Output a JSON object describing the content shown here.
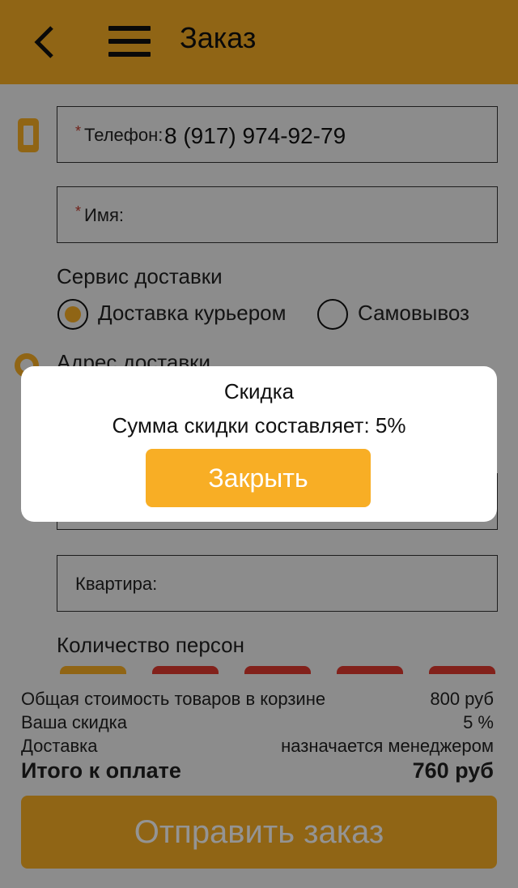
{
  "header": {
    "title": "Заказ",
    "back_icon": "chevron-left-icon",
    "menu_icon": "hamburger-icon"
  },
  "form": {
    "required_mark": "*",
    "phone": {
      "label": "Телефон:",
      "value": "8 (917) 974-92-79",
      "icon": "phone-icon"
    },
    "name": {
      "label": "Имя:",
      "value": ""
    },
    "delivery_service": {
      "label": "Сервис доставки",
      "options": [
        {
          "label": "Доставка курьером",
          "selected": true
        },
        {
          "label": "Самовывоз",
          "selected": false
        }
      ]
    },
    "address": {
      "label": "Адрес доставки",
      "icon": "location-pin-icon"
    },
    "apartment": {
      "label": "Квартира:",
      "value": ""
    },
    "persons": {
      "label": "Количество персон"
    }
  },
  "summary": {
    "goods_label": "Общая стоимость товаров в корзине",
    "goods_value": "800 руб",
    "discount_label": "Ваша скидка",
    "discount_value": "5 %",
    "delivery_label": "Доставка",
    "delivery_value": "назначается менеджером",
    "total_label": "Итого к оплате",
    "total_value": "760 руб"
  },
  "submit_label": "Отправить заказ",
  "modal": {
    "title": "Скидка",
    "text": "Сумма скидки составляет: 5%",
    "close_label": "Закрыть"
  },
  "colors": {
    "accent": "#f8ae25",
    "person_button_1": "#f8ae25",
    "person_button_other": "#e03a2f",
    "required": "#c0392b"
  }
}
